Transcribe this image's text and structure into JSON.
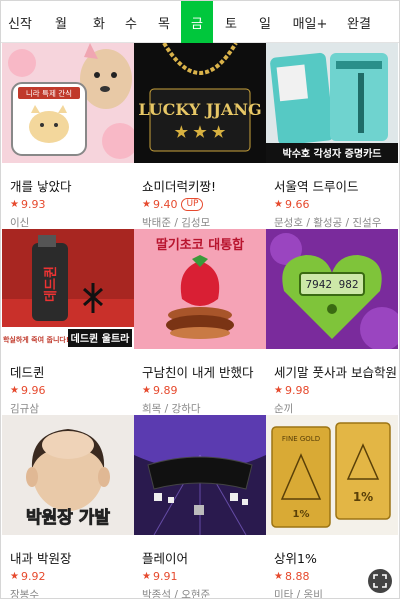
{
  "tabs": [
    {
      "label": "신작",
      "active": false
    },
    {
      "label": "월",
      "active": false
    },
    {
      "label": "화",
      "active": false
    },
    {
      "label": "수",
      "active": false
    },
    {
      "label": "목",
      "active": false
    },
    {
      "label": "금",
      "active": true
    },
    {
      "label": "토",
      "active": false
    },
    {
      "label": "일",
      "active": false
    },
    {
      "label": "매일+",
      "active": false
    },
    {
      "label": "완결",
      "active": false
    }
  ],
  "items": [
    {
      "title": "개를 낳았다",
      "rating": "9.93",
      "author": "이신",
      "badge": "",
      "thumb_text": "니라 특제 간식",
      "accent": "#f0a6b2"
    },
    {
      "title": "쇼미더럭키짱!",
      "rating": "9.40",
      "author": "박태준 / 김성모",
      "badge": "UP",
      "thumb_text": "LUCKY JJANG",
      "accent": "#caa040"
    },
    {
      "title": "서울역 드루이드",
      "rating": "9.66",
      "author": "문성호 / 활성공 / 진설우",
      "badge": "",
      "thumb_text": "박수호 각성자 증명카드",
      "accent": "#55c6c2"
    },
    {
      "title": "데드퀸",
      "rating": "9.96",
      "author": "김규삼",
      "badge": "",
      "thumb_text": "데드퀸 울트라",
      "thumb_subtext": "학실하게 죽여 줍니다!",
      "accent": "#c8231d"
    },
    {
      "title": "구남친이 내게 반했다",
      "rating": "9.89",
      "author": "희목 / 강하다",
      "badge": "",
      "thumb_text": "딸기초코 대통합",
      "accent": "#f07a96"
    },
    {
      "title": "세기말 풋사과 보습학원",
      "rating": "9.98",
      "author": "순끼",
      "badge": "",
      "thumb_text": "7942 982",
      "accent": "#6aa824"
    },
    {
      "title": "내과 박원장",
      "rating": "9.92",
      "author": "장봉수",
      "badge": "",
      "thumb_text": "박원장 가발",
      "accent": "#cfcbc6"
    },
    {
      "title": "플레이어",
      "rating": "9.91",
      "author": "박종석 / 오현준",
      "badge": "",
      "thumb_text": "",
      "accent": "#7c5fd1"
    },
    {
      "title": "상위1%",
      "rating": "8.88",
      "author": "미타 / 옹비",
      "badge": "",
      "thumb_text": "FINE GOLD",
      "thumb_subtext": "1%",
      "accent": "#d4a52a"
    }
  ],
  "ui": {
    "star": "★",
    "expand_icon": "expand-arrows-icon"
  }
}
